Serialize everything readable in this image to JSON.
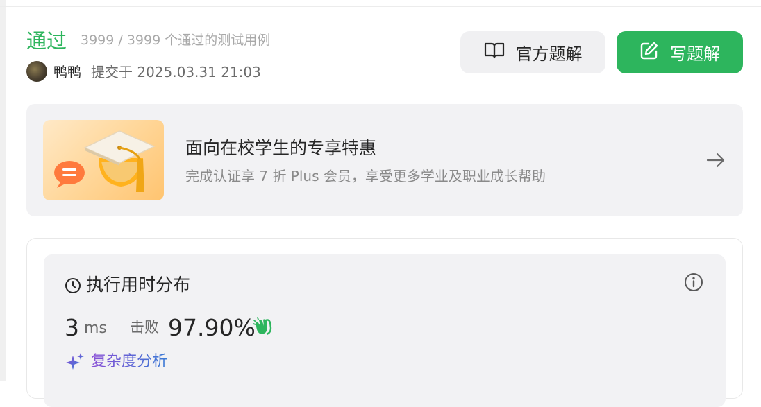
{
  "result": {
    "status": "通过",
    "testcases": "3999 / 3999 个通过的测试用例",
    "username": "鸭鸭",
    "submitted": "提交于 2025.03.31 21:03"
  },
  "actions": {
    "official_label": "官方题解",
    "write_label": "写题解"
  },
  "promo": {
    "title": "面向在校学生的专享特惠",
    "subtitle": "完成认证享 7 折 Plus 会员，享受更多学业及职业成长帮助"
  },
  "runtime": {
    "title": "执行用时分布",
    "value": "3",
    "unit": "ms",
    "beat_label": "击败",
    "beat_value": "97.90%",
    "complexity_label": "复杂度分析"
  },
  "colors": {
    "accent_green": "#2db55d",
    "muted_gray": "#a8a8a8",
    "panel_gray": "#f2f2f4"
  },
  "icons": {
    "official": "book-open-icon",
    "write": "edit-icon",
    "promo": "graduation-cap-icon",
    "arrow": "arrow-right-icon",
    "distribution": "clock-icon",
    "info": "info-icon",
    "clap": "clapping-hands-icon",
    "complexity": "sparkle-icon"
  }
}
